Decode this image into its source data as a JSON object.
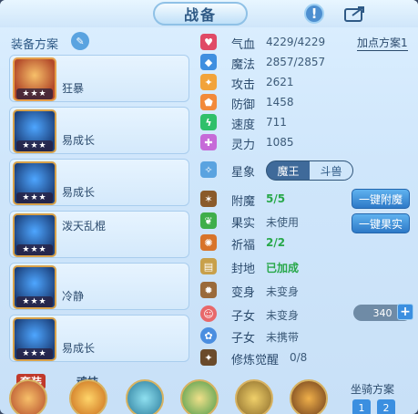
{
  "title": "战备",
  "equip": {
    "title": "装备方案",
    "items": [
      {
        "name": "狂暴",
        "stars": "★★★",
        "style": "red"
      },
      {
        "name": "易成长",
        "stars": "★★★",
        "style": "blue"
      },
      {
        "name": "易成长",
        "stars": "★★★",
        "style": "blue"
      },
      {
        "name": "泼天乱棍",
        "stars": "★★★",
        "style": "blue"
      },
      {
        "name": "冷静",
        "stars": "★★★",
        "style": "blue"
      },
      {
        "name": "易成长",
        "stars": "★★★",
        "style": "blue"
      }
    ]
  },
  "stats": {
    "scheme_label": "加点方案1",
    "rows": [
      {
        "label": "气血",
        "value": "4229/4229",
        "color": "#e04a66",
        "icon": "heart-icon",
        "glyph": "♥"
      },
      {
        "label": "魔法",
        "value": "2857/2857",
        "color": "#3f8fe0",
        "icon": "mana-icon",
        "glyph": "◆"
      },
      {
        "label": "攻击",
        "value": "2621",
        "color": "#f2a33a",
        "icon": "attack-icon",
        "glyph": "✦"
      },
      {
        "label": "防御",
        "value": "1458",
        "color": "#f28a3a",
        "icon": "defense-icon",
        "glyph": "⬟"
      },
      {
        "label": "速度",
        "value": "711",
        "color": "#2fc06a",
        "icon": "speed-icon",
        "glyph": "ϟ"
      },
      {
        "label": "灵力",
        "value": "1085",
        "color": "#c66ad8",
        "icon": "spirit-icon",
        "glyph": "✚"
      }
    ],
    "xingxiang": {
      "label": "星象",
      "options": [
        "魔王",
        "斗兽"
      ],
      "active": 1
    },
    "enhance": [
      {
        "label": "附魔",
        "value": "5/5",
        "green": true
      },
      {
        "label": "果实",
        "value": "未使用",
        "green": false
      },
      {
        "label": "祈福",
        "value": "2/2",
        "green": true
      },
      {
        "label": "封地",
        "value": "已加成",
        "green": true
      },
      {
        "label": "变身",
        "value": "未变身",
        "green": false
      },
      {
        "label": "子女",
        "value": "未变身",
        "green": false
      },
      {
        "label": "子女",
        "value": "未携带",
        "green": false
      },
      {
        "label": "修炼觉醒",
        "value": "0/8",
        "green": false
      }
    ],
    "btn_enchant": "一键附魔",
    "btn_fruit": "一键果实",
    "counter": "340",
    "plus": "+"
  },
  "bottom": {
    "tab1": "套装",
    "tab2": "魂技",
    "mount_label": "坐骑方案",
    "mount_buttons": [
      "1",
      "2"
    ]
  }
}
